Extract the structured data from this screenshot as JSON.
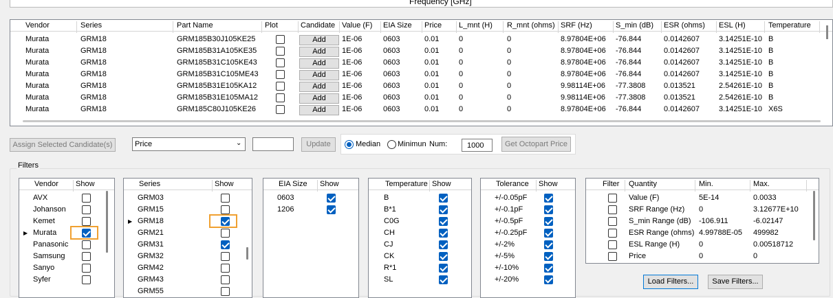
{
  "top": {
    "frequency_label": "Frequency [GHz]"
  },
  "grid": {
    "columns": [
      "Vendor",
      "Series",
      "Part Name",
      "Plot",
      "Candidate",
      "Value (F)",
      "EIA Size",
      "Price",
      "L_mnt (H)",
      "R_mnt (ohms)",
      "SRF (Hz)",
      "S_min (dB)",
      "ESR (ohms)",
      "ESL (H)",
      "Temperature"
    ],
    "add_label": "Add",
    "rows": [
      {
        "vendor": "Murata",
        "series": "GRM18",
        "part": "GRM185B30J105KE25",
        "value": "1E-06",
        "eia": "0603",
        "price": "0.01",
        "lmnt": "0",
        "rmnt": "0",
        "srf": "8.97804E+06",
        "smin": "-76.844",
        "esr": "0.0142607",
        "esl": "3.14251E-10",
        "temp": "B"
      },
      {
        "vendor": "Murata",
        "series": "GRM18",
        "part": "GRM185B31A105KE35",
        "value": "1E-06",
        "eia": "0603",
        "price": "0.01",
        "lmnt": "0",
        "rmnt": "0",
        "srf": "8.97804E+06",
        "smin": "-76.844",
        "esr": "0.0142607",
        "esl": "3.14251E-10",
        "temp": "B"
      },
      {
        "vendor": "Murata",
        "series": "GRM18",
        "part": "GRM185B31C105KE43",
        "value": "1E-06",
        "eia": "0603",
        "price": "0.01",
        "lmnt": "0",
        "rmnt": "0",
        "srf": "8.97804E+06",
        "smin": "-76.844",
        "esr": "0.0142607",
        "esl": "3.14251E-10",
        "temp": "B"
      },
      {
        "vendor": "Murata",
        "series": "GRM18",
        "part": "GRM185B31C105ME43",
        "value": "1E-06",
        "eia": "0603",
        "price": "0.01",
        "lmnt": "0",
        "rmnt": "0",
        "srf": "8.97804E+06",
        "smin": "-76.844",
        "esr": "0.0142607",
        "esl": "3.14251E-10",
        "temp": "B"
      },
      {
        "vendor": "Murata",
        "series": "GRM18",
        "part": "GRM185B31E105KA12",
        "value": "1E-06",
        "eia": "0603",
        "price": "0.01",
        "lmnt": "0",
        "rmnt": "0",
        "srf": "9.98114E+06",
        "smin": "-77.3808",
        "esr": "0.013521",
        "esl": "2.54261E-10",
        "temp": "B"
      },
      {
        "vendor": "Murata",
        "series": "GRM18",
        "part": "GRM185B31E105MA12",
        "value": "1E-06",
        "eia": "0603",
        "price": "0.01",
        "lmnt": "0",
        "rmnt": "0",
        "srf": "9.98114E+06",
        "smin": "-77.3808",
        "esr": "0.013521",
        "esl": "2.54261E-10",
        "temp": "B"
      },
      {
        "vendor": "Murata",
        "series": "GRM18",
        "part": "GRM185C80J105KE26",
        "value": "1E-06",
        "eia": "0603",
        "price": "0.01",
        "lmnt": "0",
        "rmnt": "0",
        "srf": "8.97804E+06",
        "smin": "-76.844",
        "esr": "0.0142607",
        "esl": "3.14251E-10",
        "temp": "X6S"
      }
    ]
  },
  "controls": {
    "assign_label": "Assign Selected Candidate(s)",
    "sort_value": "Price",
    "update_label": "Update",
    "median_label": "Median",
    "minimum_label": "Minimun",
    "num_label": "Num:",
    "num_value": "1000",
    "octopart_label": "Get Octopart Price"
  },
  "filters": {
    "group_label": "Filters",
    "vendor": {
      "h1": "Vendor",
      "h2": "Show",
      "items": [
        {
          "label": "AVX",
          "checked": false
        },
        {
          "label": "Johanson",
          "checked": false
        },
        {
          "label": "Kemet",
          "checked": false
        },
        {
          "label": "Murata",
          "checked": true
        },
        {
          "label": "Panasonic",
          "checked": false
        },
        {
          "label": "Samsung",
          "checked": false
        },
        {
          "label": "Sanyo",
          "checked": false
        },
        {
          "label": "Syfer",
          "checked": false
        }
      ]
    },
    "series": {
      "h1": "Series",
      "h2": "Show",
      "items": [
        {
          "label": "GRM03",
          "checked": false
        },
        {
          "label": "GRM15",
          "checked": false
        },
        {
          "label": "GRM18",
          "checked": true
        },
        {
          "label": "GRM21",
          "checked": false
        },
        {
          "label": "GRM31",
          "checked": true
        },
        {
          "label": "GRM32",
          "checked": false
        },
        {
          "label": "GRM42",
          "checked": false
        },
        {
          "label": "GRM43",
          "checked": false
        },
        {
          "label": "GRM55",
          "checked": false
        }
      ]
    },
    "eia": {
      "h1": "EIA Size",
      "h2": "Show",
      "items": [
        {
          "label": "0603",
          "checked": true
        },
        {
          "label": "1206",
          "checked": true
        }
      ]
    },
    "temperature": {
      "h1": "Temperature",
      "h2": "Show",
      "items": [
        {
          "label": "B",
          "checked": true
        },
        {
          "label": "B*1",
          "checked": true
        },
        {
          "label": "C0G",
          "checked": true
        },
        {
          "label": "CH",
          "checked": true
        },
        {
          "label": "CJ",
          "checked": true
        },
        {
          "label": "CK",
          "checked": true
        },
        {
          "label": "R*1",
          "checked": true
        },
        {
          "label": "SL",
          "checked": true
        }
      ]
    },
    "tolerance": {
      "h1": "Tolerance",
      "h2": "Show",
      "items": [
        {
          "label": "+/-0.05pF",
          "checked": true
        },
        {
          "label": "+/-0.1pF",
          "checked": true
        },
        {
          "label": "+/-0.5pF",
          "checked": true
        },
        {
          "label": "+/-0.25pF",
          "checked": true
        },
        {
          "label": "+/-2%",
          "checked": true
        },
        {
          "label": "+/-5%",
          "checked": true
        },
        {
          "label": "+/-10%",
          "checked": true
        },
        {
          "label": "+/-20%",
          "checked": true
        }
      ]
    },
    "quantity": {
      "h1": "Filter",
      "h2": "Quantity",
      "h3": "Min.",
      "h4": "Max.",
      "items": [
        {
          "label": "Value (F)",
          "min": "5E-14",
          "max": "0.0033",
          "checked": false
        },
        {
          "label": "SRF Range (Hz)",
          "min": "0",
          "max": "3.12677E+10",
          "checked": false
        },
        {
          "label": "S_min Range (dB)",
          "min": "-106.911",
          "max": "-6.02147",
          "checked": false
        },
        {
          "label": "ESR Range (ohms)",
          "min": "4.99788E-05",
          "max": "499982",
          "checked": false
        },
        {
          "label": "ESL Range (H)",
          "min": "0",
          "max": "0.00518712",
          "checked": false
        },
        {
          "label": "Price",
          "min": "0",
          "max": "0",
          "checked": false
        }
      ]
    },
    "load_label": "Load Filters...",
    "save_label": "Save Filters..."
  }
}
